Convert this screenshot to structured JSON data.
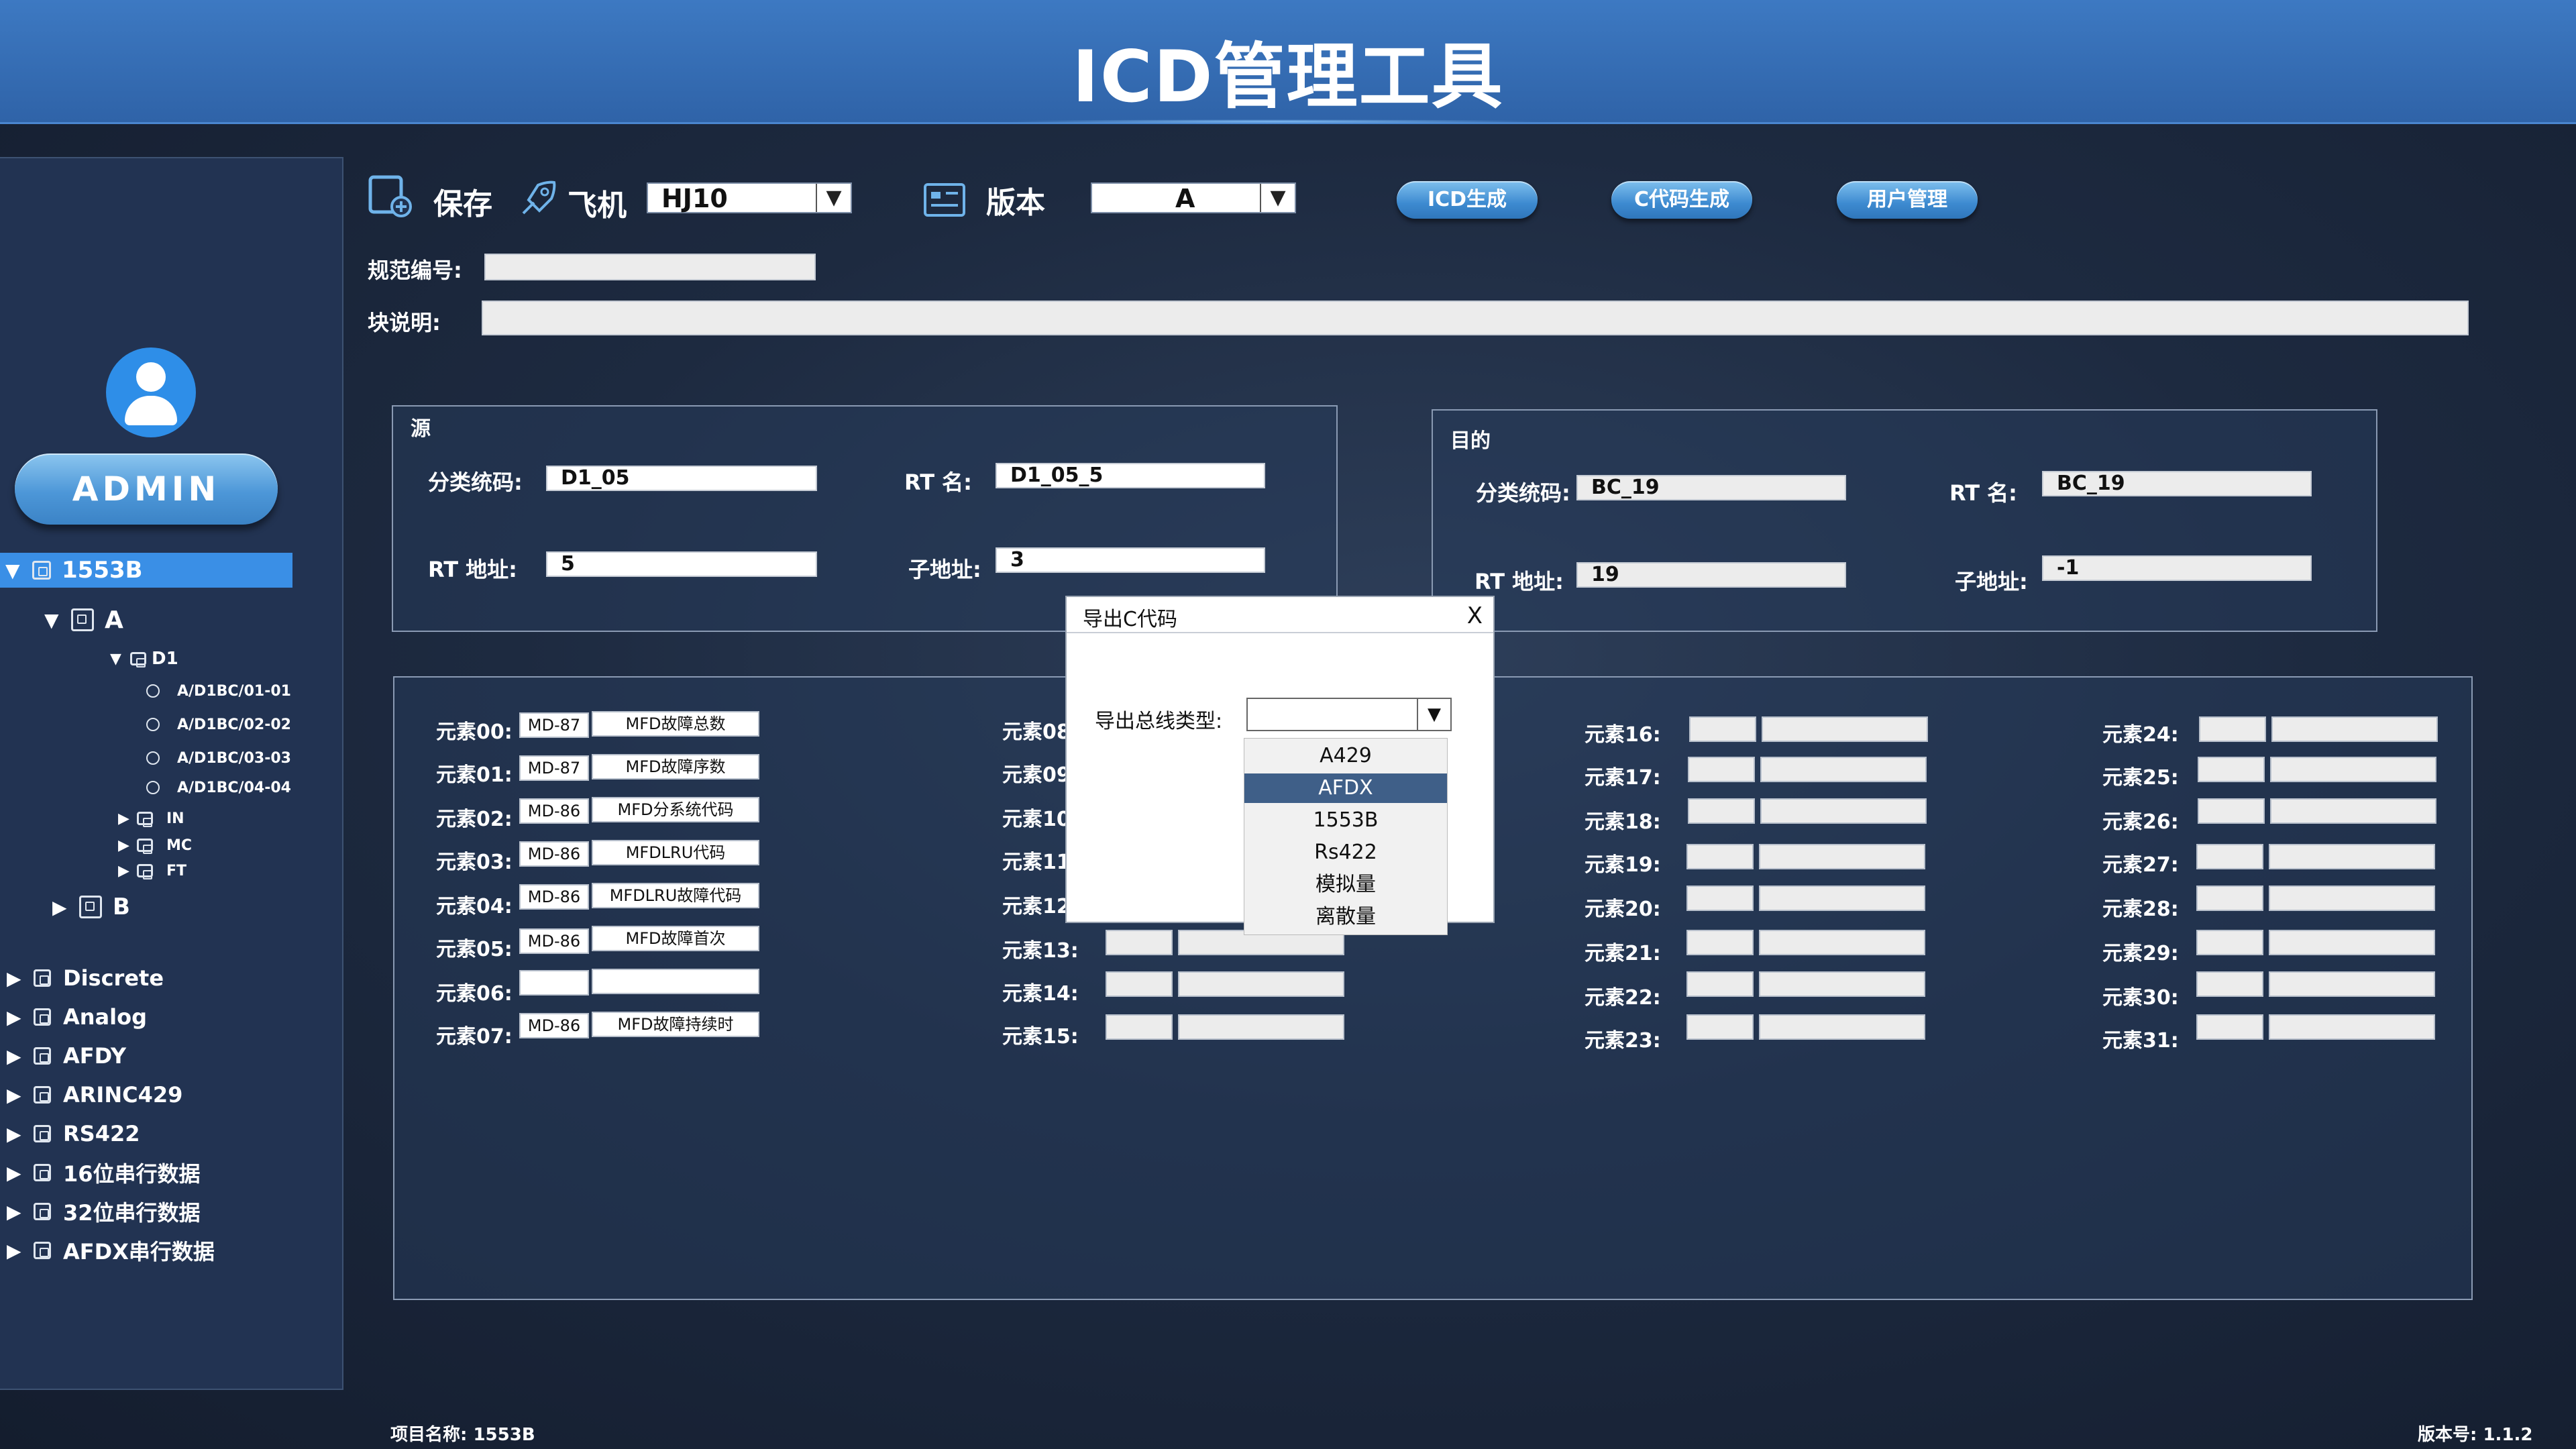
{
  "header": {
    "title": "ICD管理工具"
  },
  "user": {
    "name": "ADMIN"
  },
  "tree": {
    "root": "1553B",
    "a": "A",
    "d1": "D1",
    "leaves": [
      "A/D1BC/01-01",
      "A/D1BC/02-02",
      "A/D1BC/03-03",
      "A/D1BC/04-04"
    ],
    "subs": [
      "IN",
      "MC",
      "FT"
    ],
    "b": "B",
    "others": [
      "Discrete",
      "Analog",
      "AFDY",
      "ARINC429",
      "RS422",
      "16位串行数据",
      "32位串行数据",
      "AFDX串行数据"
    ]
  },
  "toolbar": {
    "save_label": "保存",
    "plane_label": "飞机",
    "plane_value": "HJ10",
    "version_label": "版本",
    "version_value": "A",
    "btn_icd": "ICD生成",
    "btn_c": "C代码生成",
    "btn_user": "用户管理"
  },
  "spec": {
    "label": "规范编号:",
    "value": ""
  },
  "block": {
    "label": "块说明:",
    "value": ""
  },
  "source": {
    "title": "源",
    "class_label": "分类统码:",
    "class_value": "D1_05",
    "rtname_label": "RT 名:",
    "rtname_value": "D1_05_5",
    "rtaddr_label": "RT 地址:",
    "rtaddr_value": "5",
    "subaddr_label": "子地址:",
    "subaddr_value": "3"
  },
  "dest": {
    "title": "目的",
    "class_label": "分类统码:",
    "class_value": "BC_19",
    "rtname_label": "RT 名:",
    "rtname_value": "BC_19",
    "rtaddr_label": "RT 地址:",
    "rtaddr_value": "19",
    "subaddr_label": "子地址:",
    "subaddr_value": "-1"
  },
  "elements": {
    "col1": [
      {
        "label": "元素00:",
        "code": "MD-87",
        "desc": "MFD故障总数"
      },
      {
        "label": "元素01:",
        "code": "MD-87",
        "desc": "MFD故障序数"
      },
      {
        "label": "元素02:",
        "code": "MD-86",
        "desc": "MFD分系统代码"
      },
      {
        "label": "元素03:",
        "code": "MD-86",
        "desc": "MFDLRU代码"
      },
      {
        "label": "元素04:",
        "code": "MD-86",
        "desc": "MFDLRU故障代码"
      },
      {
        "label": "元素05:",
        "code": "MD-86",
        "desc": "MFD故障首次"
      },
      {
        "label": "元素06:",
        "code": "",
        "desc": ""
      },
      {
        "label": "元素07:",
        "code": "MD-86",
        "desc": "MFD故障持续时"
      }
    ],
    "col2": [
      {
        "label": "元素08"
      },
      {
        "label": "元素09"
      },
      {
        "label": "元素10"
      },
      {
        "label": "元素11"
      },
      {
        "label": "元素12"
      },
      {
        "label": "元素13:"
      },
      {
        "label": "元素14:"
      },
      {
        "label": "元素15:"
      }
    ],
    "col3": [
      {
        "label": "元素16:"
      },
      {
        "label": "元素17:"
      },
      {
        "label": "元素18:"
      },
      {
        "label": "元素19:"
      },
      {
        "label": "元素20:"
      },
      {
        "label": "元素21:"
      },
      {
        "label": "元素22:"
      },
      {
        "label": "元素23:"
      }
    ],
    "col4": [
      {
        "label": "元素24:"
      },
      {
        "label": "元素25:"
      },
      {
        "label": "元素26:"
      },
      {
        "label": "元素27:"
      },
      {
        "label": "元素28:"
      },
      {
        "label": "元素29:"
      },
      {
        "label": "元素30:"
      },
      {
        "label": "元素31:"
      }
    ]
  },
  "dialog": {
    "title": "导出C代码",
    "close": "X",
    "label": "导出总线类型:",
    "selected": "",
    "options": [
      "A429",
      "AFDX",
      "1553B",
      "Rs422",
      "模拟量",
      "离散量"
    ],
    "highlighted": "AFDX"
  },
  "footer": {
    "project": "项目名称: 1553B",
    "version": "版本号: 1.1.2"
  }
}
